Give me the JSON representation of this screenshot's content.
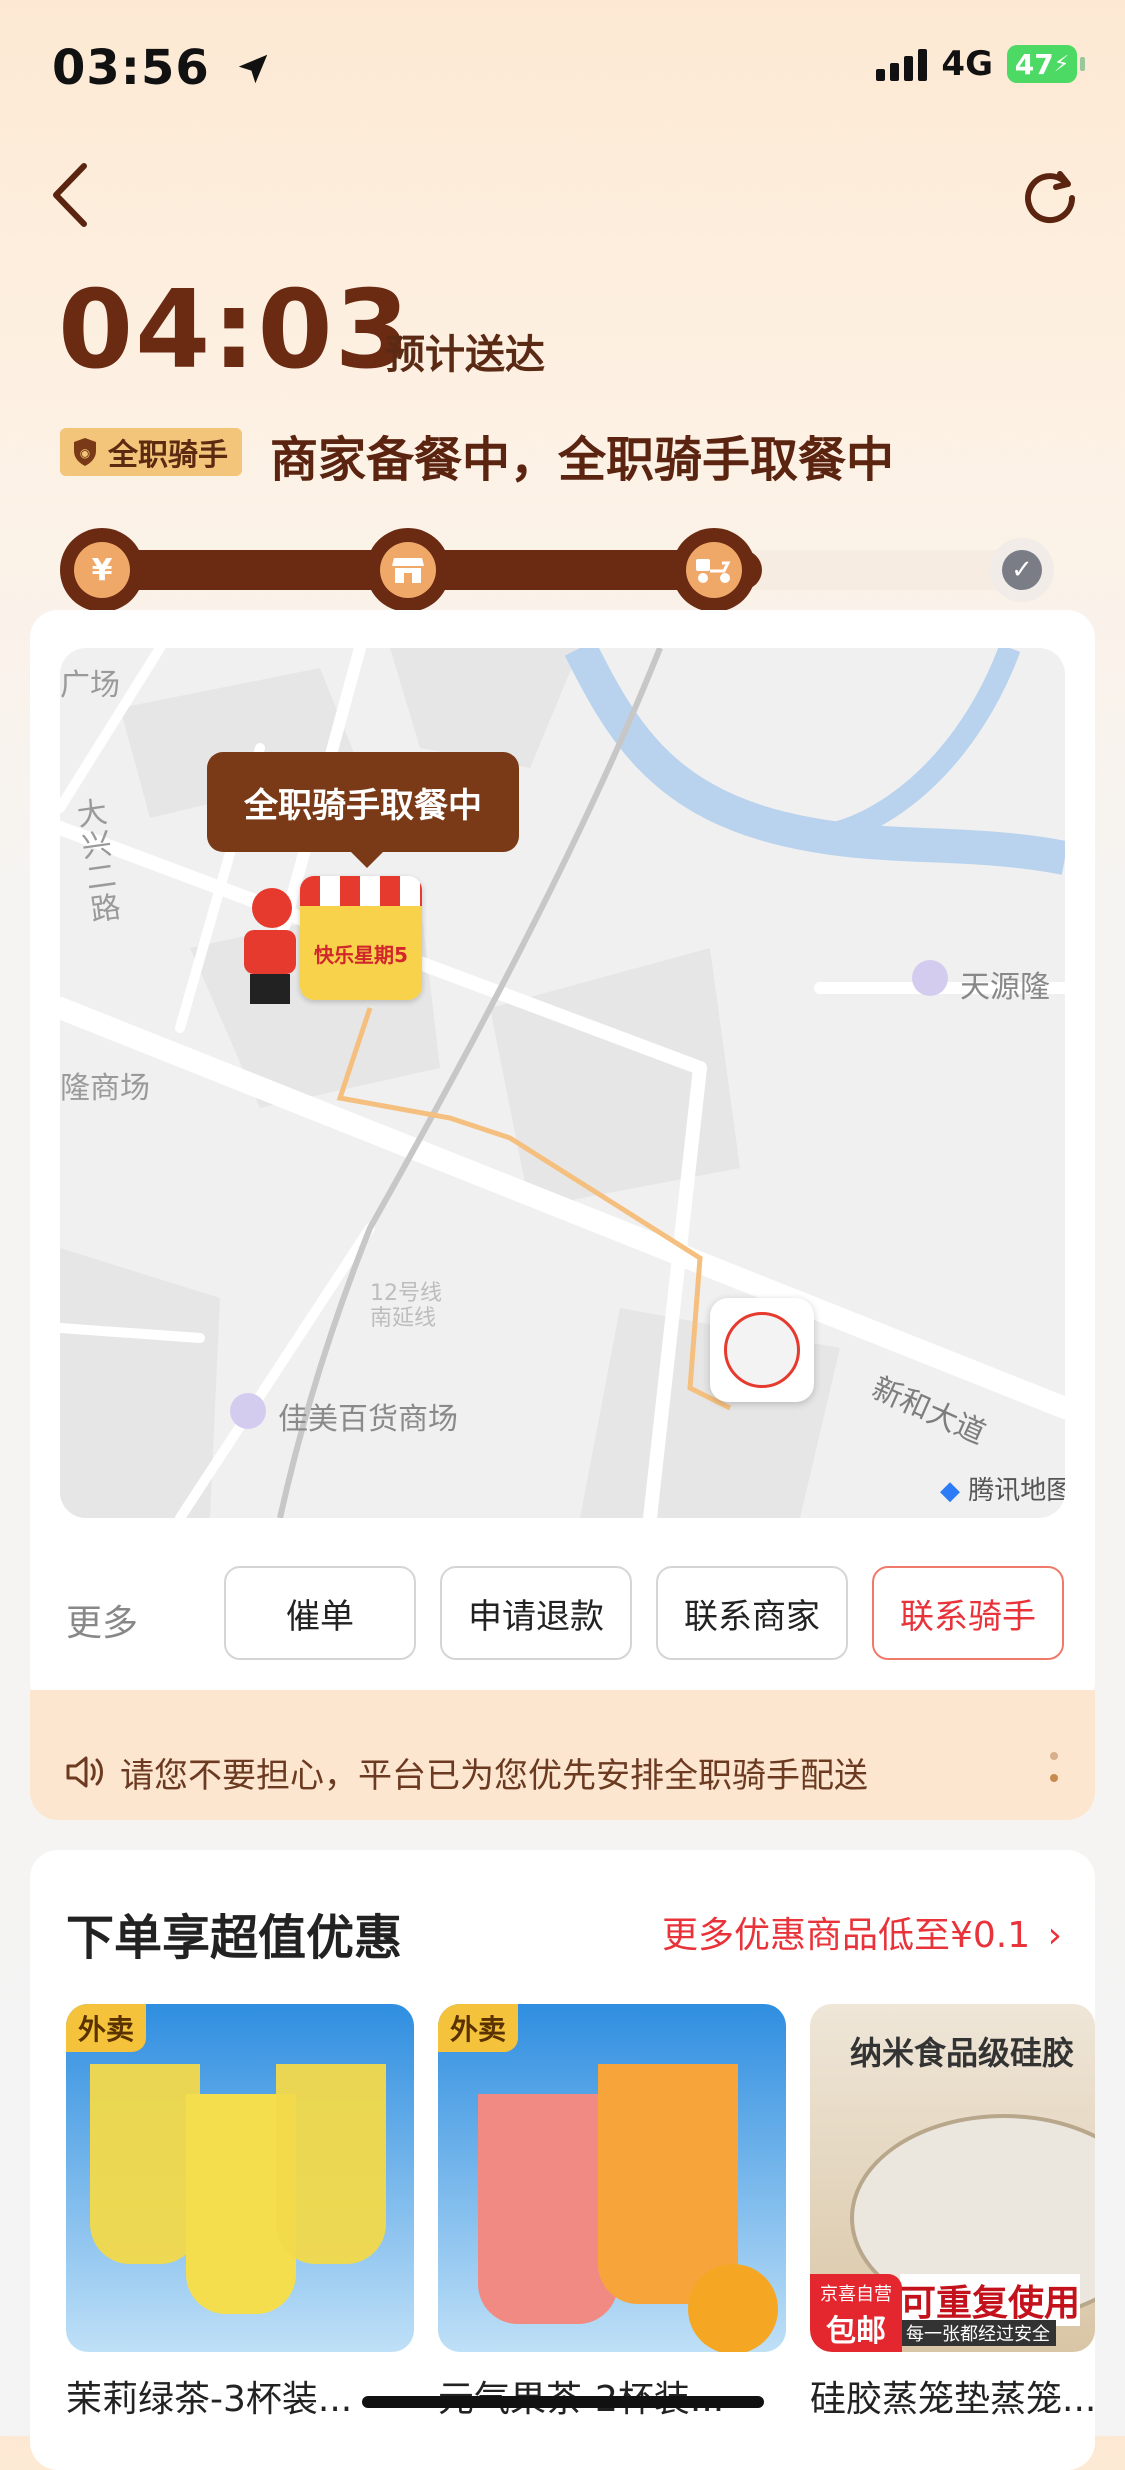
{
  "status_bar": {
    "time": "03:56",
    "network": "4G",
    "battery": "47"
  },
  "header": {
    "eta_time": "04:03",
    "eta_label": "预计送达",
    "rider_badge": "全职骑手",
    "status_text": "商家备餐中，全职骑手取餐中"
  },
  "progress": {
    "step_pay_icon": "¥",
    "current_step": 3,
    "total_steps": 4
  },
  "map": {
    "bubble_text": "全职骑手取餐中",
    "labels": {
      "top_left": "广场",
      "road_daxing": "大兴二路",
      "tianyuan": "天源隆",
      "longshang": "隆商场",
      "line12": "12号线",
      "line_nan": "南延线",
      "jiamei": "佳美百货商场",
      "xinhe": "新和大道",
      "provider": "腾讯地图"
    },
    "store_sign": "快乐星期5"
  },
  "actions": {
    "more_label": "更多",
    "urge": "催单",
    "refund": "申请退款",
    "contact_merchant": "联系商家",
    "contact_rider": "联系骑手"
  },
  "notice": {
    "text": "请您不要担心，平台已为您优先安排全职骑手配送"
  },
  "promo": {
    "title": "下单享超值优惠",
    "more": "更多优惠商品低至¥0.1",
    "products": [
      {
        "tag": "外卖",
        "name": "茉莉绿茶-3杯装..."
      },
      {
        "tag": "外卖",
        "name": "元气果茶-2杯装..."
      },
      {
        "banner": "纳米食品级硅胶",
        "subbanner": "可重复使用",
        "badge_top": "京喜自营",
        "badge_main": "包邮",
        "badge_note": "每一张都经过安全",
        "name": "硅胶蒸笼垫蒸笼..."
      }
    ]
  },
  "colors": {
    "brand_brown": "#6b2a12",
    "accent_red": "#e8333a",
    "progress_orange": "#f0a869"
  },
  "icons": [
    "navigation-arrow-icon",
    "back-arrow-icon",
    "refresh-icon",
    "shield-icon",
    "yuan-icon",
    "store-icon",
    "scooter-icon",
    "check-icon",
    "speaker-icon",
    "chevron-right-icon"
  ]
}
